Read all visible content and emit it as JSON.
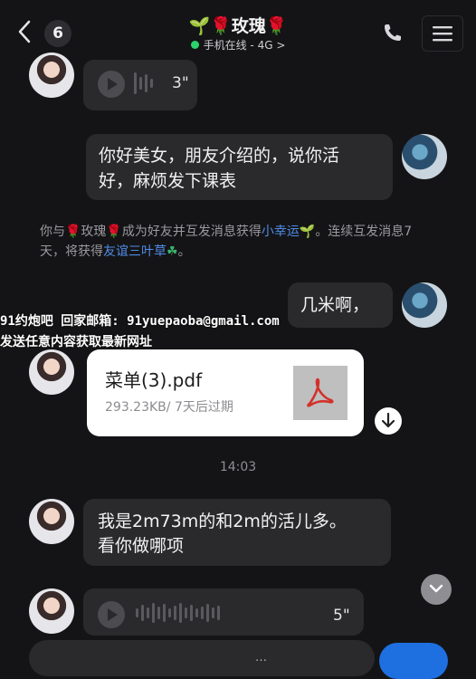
{
  "header": {
    "unread_count": "6",
    "title": "🌱🌹玫瑰🌹",
    "status": "手机在线 - 4G >",
    "icons": {
      "back": "back-arrow-icon",
      "call": "phone-icon",
      "menu": "hamburger-menu-icon"
    }
  },
  "messages": {
    "voice_1": {
      "duration": "3\""
    },
    "text_1": {
      "line1": "你好美女，朋友介绍的，说你活",
      "line2": "好，麻烦发下课表"
    },
    "system": {
      "prefix": "你与🌹玫瑰🌹成为好友并互发消息获得",
      "link1": "小幸运",
      "link1_icon": "🌱",
      "middle": "。连续互发消息7",
      "line2_prefix": "天，将获得",
      "link2": "友谊三叶草",
      "link2_icon": "☘",
      "end": "。"
    },
    "text_2": {
      "text": "几米啊，"
    },
    "file": {
      "name": "菜单(3).pdf",
      "meta": "293.23KB/ 7天后过期",
      "icon": "pdf-icon"
    },
    "time": "14:03",
    "text_3": {
      "line1": "我是2m73m的和2m的活儿多。",
      "line2": "看你做哪项"
    },
    "voice_2": {
      "duration": "5\""
    }
  },
  "watermark": {
    "line1": "91约炮吧 回家邮箱: 91yuepaoba@gmail.com",
    "line2": "发送任意内容获取最新网址"
  },
  "composer": {
    "input_text": "…"
  },
  "colors": {
    "background": "#141416",
    "bubble": "#2a2a2d",
    "accent": "#1e6fe0",
    "online": "#2bd36b"
  }
}
